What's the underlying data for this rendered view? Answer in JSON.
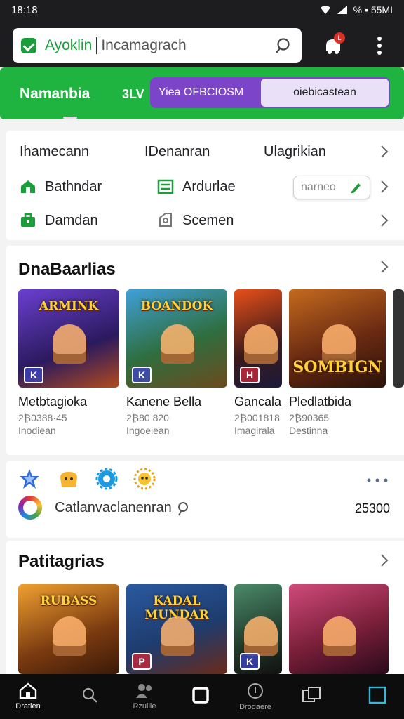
{
  "status": {
    "time": "18:18",
    "right": "% ▪ 55MI"
  },
  "search": {
    "brand": "Ayoklin",
    "query": "Incamagrach"
  },
  "notifications": {
    "badge": "L"
  },
  "greenbar": {
    "title": "Namanbia",
    "tag": "3LV",
    "pill_left": "Yiea OFBCIOSM",
    "pill_right": "oiebicastean"
  },
  "quick": {
    "tabs": [
      "Ihamecann",
      "IDenanran",
      "Ulagrikian"
    ],
    "row2": [
      {
        "label": "Bathndar",
        "icon": "home-icon"
      },
      {
        "label": "Ardurlae",
        "icon": "grid-icon"
      }
    ],
    "chip": "narneo",
    "row3": [
      {
        "label": "Damdan",
        "icon": "briefcase-icon"
      },
      {
        "label": "Scemen",
        "icon": "tag-icon"
      }
    ]
  },
  "section1": {
    "title": "DnaBaarlias",
    "games": [
      {
        "name": "Metbtagioka",
        "meta": "2₿0388·45",
        "sub": "Inodiean",
        "art": "ARMINK",
        "badge": "K",
        "bg": "#3a2f7a"
      },
      {
        "name": "Kanene Bella",
        "meta": "2₿80 820",
        "sub": "Ingoeiean",
        "art": "BOANDOK",
        "badge": "K",
        "bg": "#2f6e3f"
      },
      {
        "name": "Gancala",
        "meta": "2₿001818",
        "sub": "Imagirala",
        "art": "",
        "badge": "H",
        "bg": "#3b1a1a"
      },
      {
        "name": "Pledlatbida",
        "meta": "2₿90365",
        "sub": "Destinna",
        "art": "SOMBIGN",
        "badge": "",
        "bg": "#6a2a12"
      }
    ]
  },
  "icons_card": {
    "icons": [
      "star-icon",
      "bag-icon",
      "gear-icon",
      "sun-icon"
    ],
    "text": "Catlanvaclanenran",
    "count": "25300"
  },
  "section2": {
    "title": "Patitagrias",
    "games": [
      {
        "art": "RUBASS",
        "badge": "",
        "bg": "#7a3a10"
      },
      {
        "art": "KADAL MUNDAR",
        "badge": "P",
        "bg": "#1e3c6e"
      },
      {
        "art": "",
        "badge": "K",
        "bg": "#223a2a"
      },
      {
        "art": "",
        "badge": "",
        "bg": "#7a1f3a"
      }
    ]
  },
  "nav": [
    {
      "label": "Dratlen",
      "icon": "home-icon"
    },
    {
      "label": "",
      "icon": "search-icon"
    },
    {
      "label": "Rzuilie",
      "icon": "people-icon"
    },
    {
      "label": "",
      "icon": "square-icon"
    },
    {
      "label": "Drodaere",
      "icon": "info-icon"
    },
    {
      "label": "",
      "icon": "copy-icon"
    },
    {
      "label": "",
      "icon": "window-icon"
    }
  ],
  "colors": {
    "green": "#1fb43f",
    "purple": "#7b44c9",
    "dark": "#1d1d1f"
  }
}
